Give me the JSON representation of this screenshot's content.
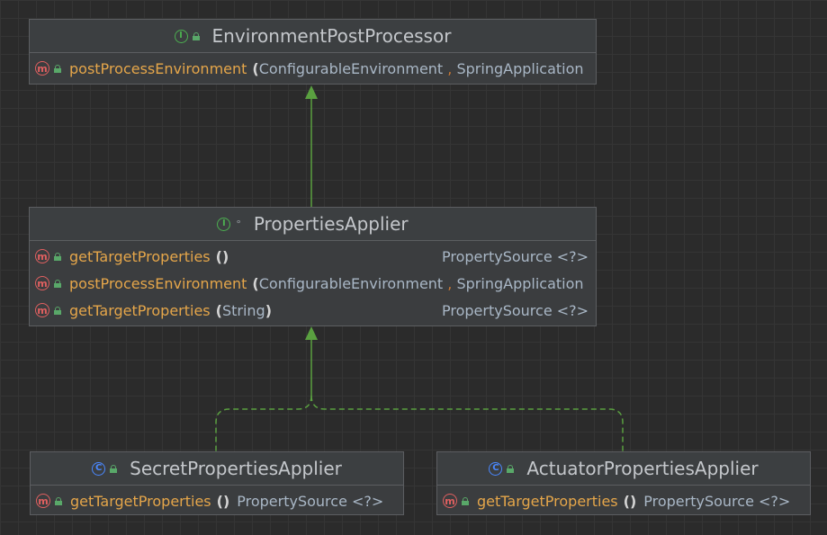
{
  "colors": {
    "background": "#2b2b2b",
    "node_background": "#3b3d3f",
    "method_name": "#e5a64a",
    "inheritance_line": "#5aa040",
    "interface_icon": "#4caf50",
    "class_icon": "#4a88ff",
    "method_icon": "#e06060"
  },
  "nodes": {
    "environment_post_processor": {
      "kind_icon": "I",
      "title": "EnvironmentPostProcessor",
      "methods": [
        {
          "icon": "m",
          "name": "postProcessEnvironment",
          "open": "(",
          "p1": "ConfigurableEnvironment",
          "comma": ",",
          "p2": "SpringApplication"
        }
      ]
    },
    "properties_applier": {
      "kind_icon": "I",
      "modifier": "°",
      "title": "PropertiesApplier",
      "methods": [
        {
          "icon": "m",
          "name": "getTargetProperties",
          "params": "()",
          "return_type": "PropertySource <?>"
        },
        {
          "icon": "m",
          "name": "postProcessEnvironment",
          "open": "(",
          "p1": "ConfigurableEnvironment",
          "comma": ",",
          "p2": "SpringApplication"
        },
        {
          "icon": "m",
          "name": "getTargetProperties",
          "open": "(",
          "p1": "String",
          "close": ")",
          "return_type": "PropertySource <?>"
        }
      ]
    },
    "secret_properties_applier": {
      "kind_icon": "C",
      "title": "SecretPropertiesApplier",
      "methods": [
        {
          "icon": "m",
          "name": "getTargetProperties",
          "params": "()",
          "return_type": "PropertySource <?>"
        }
      ]
    },
    "actuator_properties_applier": {
      "kind_icon": "C",
      "title": "ActuatorPropertiesApplier",
      "methods": [
        {
          "icon": "m",
          "name": "getTargetProperties",
          "params": "()",
          "return_type": "PropertySource <?>"
        }
      ]
    }
  },
  "edges": [
    {
      "from": "properties_applier",
      "to": "environment_post_processor",
      "type": "extends",
      "style": "solid"
    },
    {
      "from": "secret_properties_applier",
      "to": "properties_applier",
      "type": "implements",
      "style": "dashed"
    },
    {
      "from": "actuator_properties_applier",
      "to": "properties_applier",
      "type": "implements",
      "style": "dashed"
    }
  ]
}
